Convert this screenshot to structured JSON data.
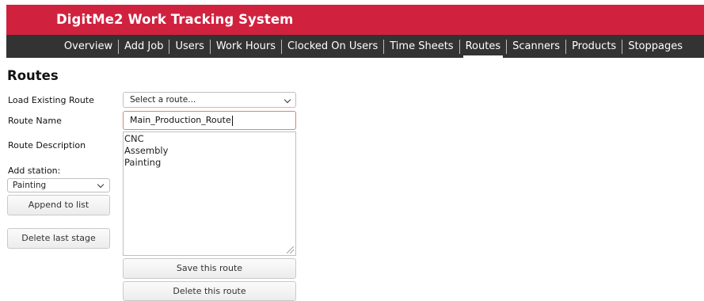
{
  "app": {
    "title": "DigitMe2 Work Tracking System"
  },
  "nav": {
    "items": [
      {
        "label": "Overview"
      },
      {
        "label": "Add Job"
      },
      {
        "label": "Users"
      },
      {
        "label": "Work Hours"
      },
      {
        "label": "Clocked On Users"
      },
      {
        "label": "Time Sheets"
      },
      {
        "label": "Routes",
        "active": true
      },
      {
        "label": "Scanners"
      },
      {
        "label": "Products"
      },
      {
        "label": "Stoppages"
      }
    ]
  },
  "page": {
    "title": "Routes",
    "load_label": "Load Existing Route",
    "load_select_value": "Select a route...",
    "name_label": "Route Name",
    "name_value": "Main_Production_Route",
    "description_label": "Route Description",
    "stages": [
      "CNC",
      "Assembly",
      "Painting"
    ],
    "add_station_label": "Add station:",
    "station_select_value": "Painting",
    "append_button": "Append to list",
    "delete_stage_button": "Delete last stage",
    "save_button": "Save this route",
    "delete_route_button": "Delete this route"
  },
  "colors": {
    "header": "#d0223f",
    "nav": "#333333",
    "input_focus_border": "#e0836a"
  }
}
